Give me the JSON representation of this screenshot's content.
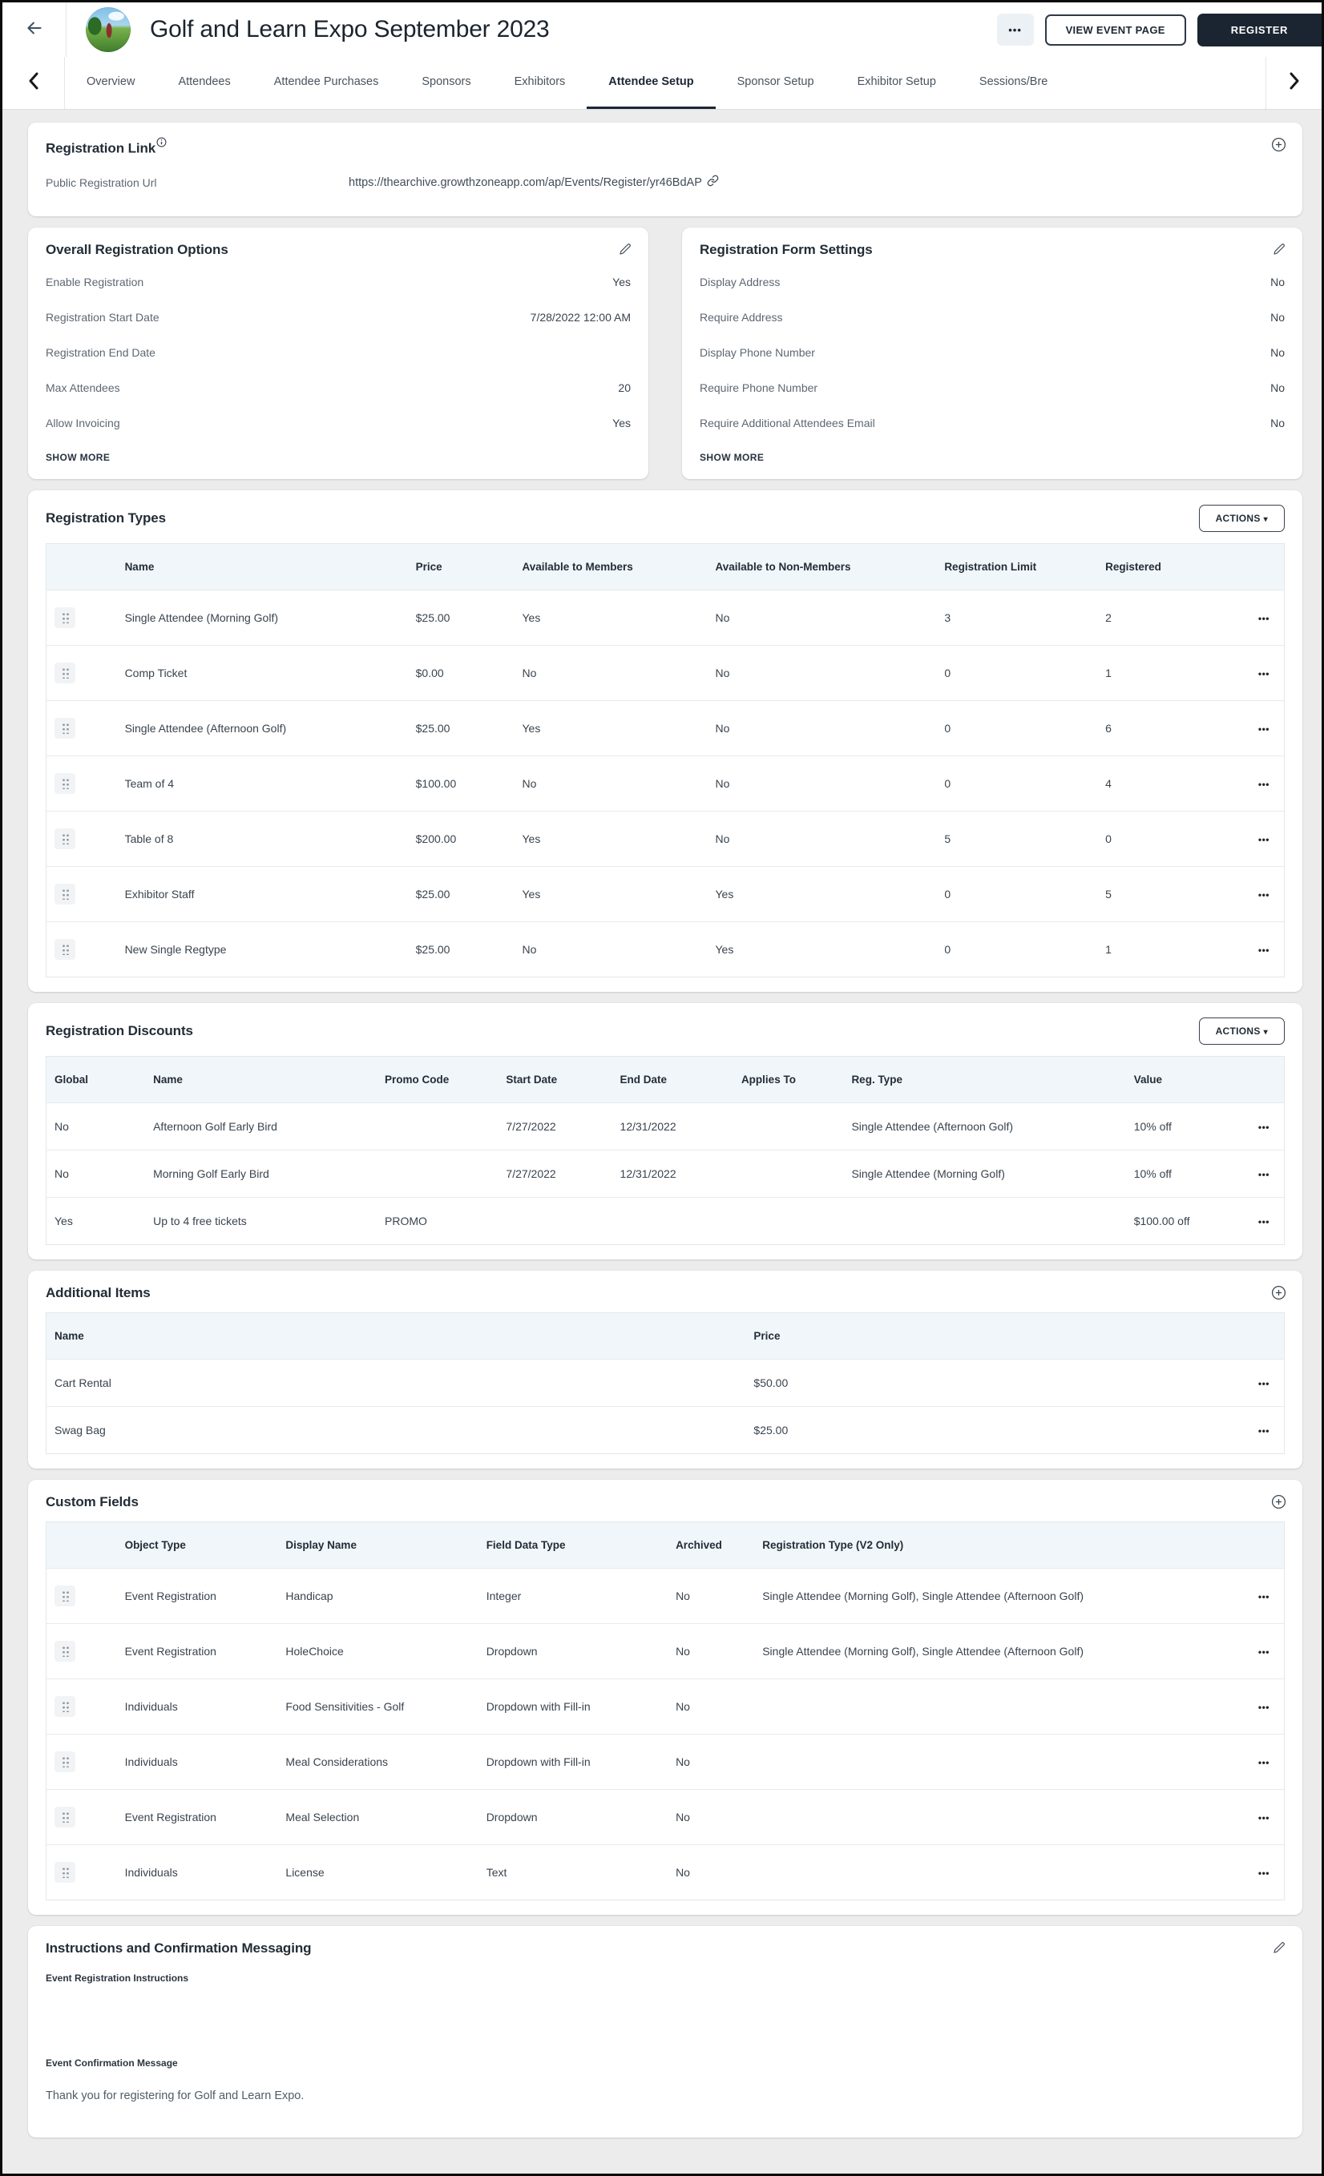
{
  "header": {
    "title": "Golf and Learn Expo September 2023",
    "kebab_label": "•••",
    "view_event_page_label": "VIEW EVENT PAGE",
    "register_label": "REGISTER"
  },
  "tabs": {
    "items": [
      {
        "label": "Overview"
      },
      {
        "label": "Attendees"
      },
      {
        "label": "Attendee Purchases"
      },
      {
        "label": "Sponsors"
      },
      {
        "label": "Exhibitors"
      },
      {
        "label": "Attendee Setup"
      },
      {
        "label": "Sponsor Setup"
      },
      {
        "label": "Exhibitor Setup"
      },
      {
        "label": "Sessions/Bre"
      }
    ],
    "active": "Attendee Setup"
  },
  "registration_link": {
    "title": "Registration Link",
    "label": "Public Registration Url",
    "url": "https://thearchive.growthzoneapp.com/ap/Events/Register/yr46BdAP"
  },
  "overall_options": {
    "title": "Overall Registration Options",
    "rows": [
      {
        "label": "Enable Registration",
        "value": "Yes"
      },
      {
        "label": "Registration Start Date",
        "value": "7/28/2022 12:00 AM"
      },
      {
        "label": "Registration End Date",
        "value": ""
      },
      {
        "label": "Max Attendees",
        "value": "20"
      },
      {
        "label": "Allow Invoicing",
        "value": "Yes"
      }
    ],
    "show_more": "SHOW MORE"
  },
  "form_settings": {
    "title": "Registration Form Settings",
    "rows": [
      {
        "label": "Display Address",
        "value": "No"
      },
      {
        "label": "Require Address",
        "value": "No"
      },
      {
        "label": "Display Phone Number",
        "value": "No"
      },
      {
        "label": "Require Phone Number",
        "value": "No"
      },
      {
        "label": "Require Additional Attendees Email",
        "value": "No"
      }
    ],
    "show_more": "SHOW MORE"
  },
  "registration_types": {
    "title": "Registration Types",
    "actions_label": "ACTIONS",
    "columns": [
      "Name",
      "Price",
      "Available to Members",
      "Available to Non-Members",
      "Registration Limit",
      "Registered"
    ],
    "rows": [
      {
        "name": "Single Attendee (Morning Golf)",
        "price": "$25.00",
        "members": "Yes",
        "non_members": "No",
        "limit": "3",
        "registered": "2",
        "kebab": "•••"
      },
      {
        "name": "Comp Ticket",
        "price": "$0.00",
        "members": "No",
        "non_members": "No",
        "limit": "0",
        "registered": "1",
        "kebab": "•••"
      },
      {
        "name": "Single Attendee (Afternoon Golf)",
        "price": "$25.00",
        "members": "Yes",
        "non_members": "No",
        "limit": "0",
        "registered": "6",
        "kebab": "•••"
      },
      {
        "name": "Team of 4",
        "price": "$100.00",
        "members": "No",
        "non_members": "No",
        "limit": "0",
        "registered": "4",
        "kebab": "•••"
      },
      {
        "name": "Table of 8",
        "price": "$200.00",
        "members": "Yes",
        "non_members": "No",
        "limit": "5",
        "registered": "0",
        "kebab": "•••"
      },
      {
        "name": "Exhibitor Staff",
        "price": "$25.00",
        "members": "Yes",
        "non_members": "Yes",
        "limit": "0",
        "registered": "5",
        "kebab": "•••"
      },
      {
        "name": "New Single Regtype",
        "price": "$25.00",
        "members": "No",
        "non_members": "Yes",
        "limit": "0",
        "registered": "1",
        "kebab": "•••"
      }
    ]
  },
  "registration_discounts": {
    "title": "Registration Discounts",
    "actions_label": "ACTIONS",
    "columns": [
      "Global",
      "Name",
      "Promo Code",
      "Start Date",
      "End Date",
      "Applies To",
      "Reg. Type",
      "Value"
    ],
    "rows": [
      {
        "global": "No",
        "name": "Afternoon Golf Early Bird",
        "promo": "",
        "start": "7/27/2022",
        "end": "12/31/2022",
        "applies": "",
        "reg_type": "Single Attendee (Afternoon Golf)",
        "value": "10% off",
        "kebab": "•••"
      },
      {
        "global": "No",
        "name": "Morning Golf Early Bird",
        "promo": "",
        "start": "7/27/2022",
        "end": "12/31/2022",
        "applies": "",
        "reg_type": "Single Attendee (Morning Golf)",
        "value": "10% off",
        "kebab": "•••"
      },
      {
        "global": "Yes",
        "name": "Up to 4 free tickets",
        "promo": "PROMO",
        "start": "",
        "end": "",
        "applies": "",
        "reg_type": "",
        "value": "$100.00 off",
        "kebab": "•••"
      }
    ]
  },
  "additional_items": {
    "title": "Additional Items",
    "columns": [
      "Name",
      "Price"
    ],
    "rows": [
      {
        "name": "Cart Rental",
        "price": "$50.00",
        "kebab": "•••"
      },
      {
        "name": "Swag Bag",
        "price": "$25.00",
        "kebab": "•••"
      }
    ]
  },
  "custom_fields": {
    "title": "Custom Fields",
    "columns": [
      "Object Type",
      "Display Name",
      "Field Data Type",
      "Archived",
      "Registration Type (V2 Only)"
    ],
    "rows": [
      {
        "object_type": "Event Registration",
        "display_name": "Handicap",
        "data_type": "Integer",
        "archived": "No",
        "reg_type": "Single Attendee (Morning Golf), Single Attendee (Afternoon Golf)",
        "kebab": "•••"
      },
      {
        "object_type": "Event Registration",
        "display_name": "HoleChoice",
        "data_type": "Dropdown",
        "archived": "No",
        "reg_type": "Single Attendee (Morning Golf), Single Attendee (Afternoon Golf)",
        "kebab": "•••"
      },
      {
        "object_type": "Individuals",
        "display_name": "Food Sensitivities - Golf",
        "data_type": "Dropdown with Fill-in",
        "archived": "No",
        "reg_type": "",
        "kebab": "•••"
      },
      {
        "object_type": "Individuals",
        "display_name": "Meal Considerations",
        "data_type": "Dropdown with Fill-in",
        "archived": "No",
        "reg_type": "",
        "kebab": "•••"
      },
      {
        "object_type": "Event Registration",
        "display_name": "Meal Selection",
        "data_type": "Dropdown",
        "archived": "No",
        "reg_type": "",
        "kebab": "•••"
      },
      {
        "object_type": "Individuals",
        "display_name": "License",
        "data_type": "Text",
        "archived": "No",
        "reg_type": "",
        "kebab": "•••"
      }
    ]
  },
  "instructions": {
    "title": "Instructions and Confirmation Messaging",
    "instructions_label": "Event Registration Instructions",
    "instructions_value": "",
    "confirmation_label": "Event Confirmation Message",
    "confirmation_value": "Thank you for registering for Golf and Learn Expo."
  }
}
